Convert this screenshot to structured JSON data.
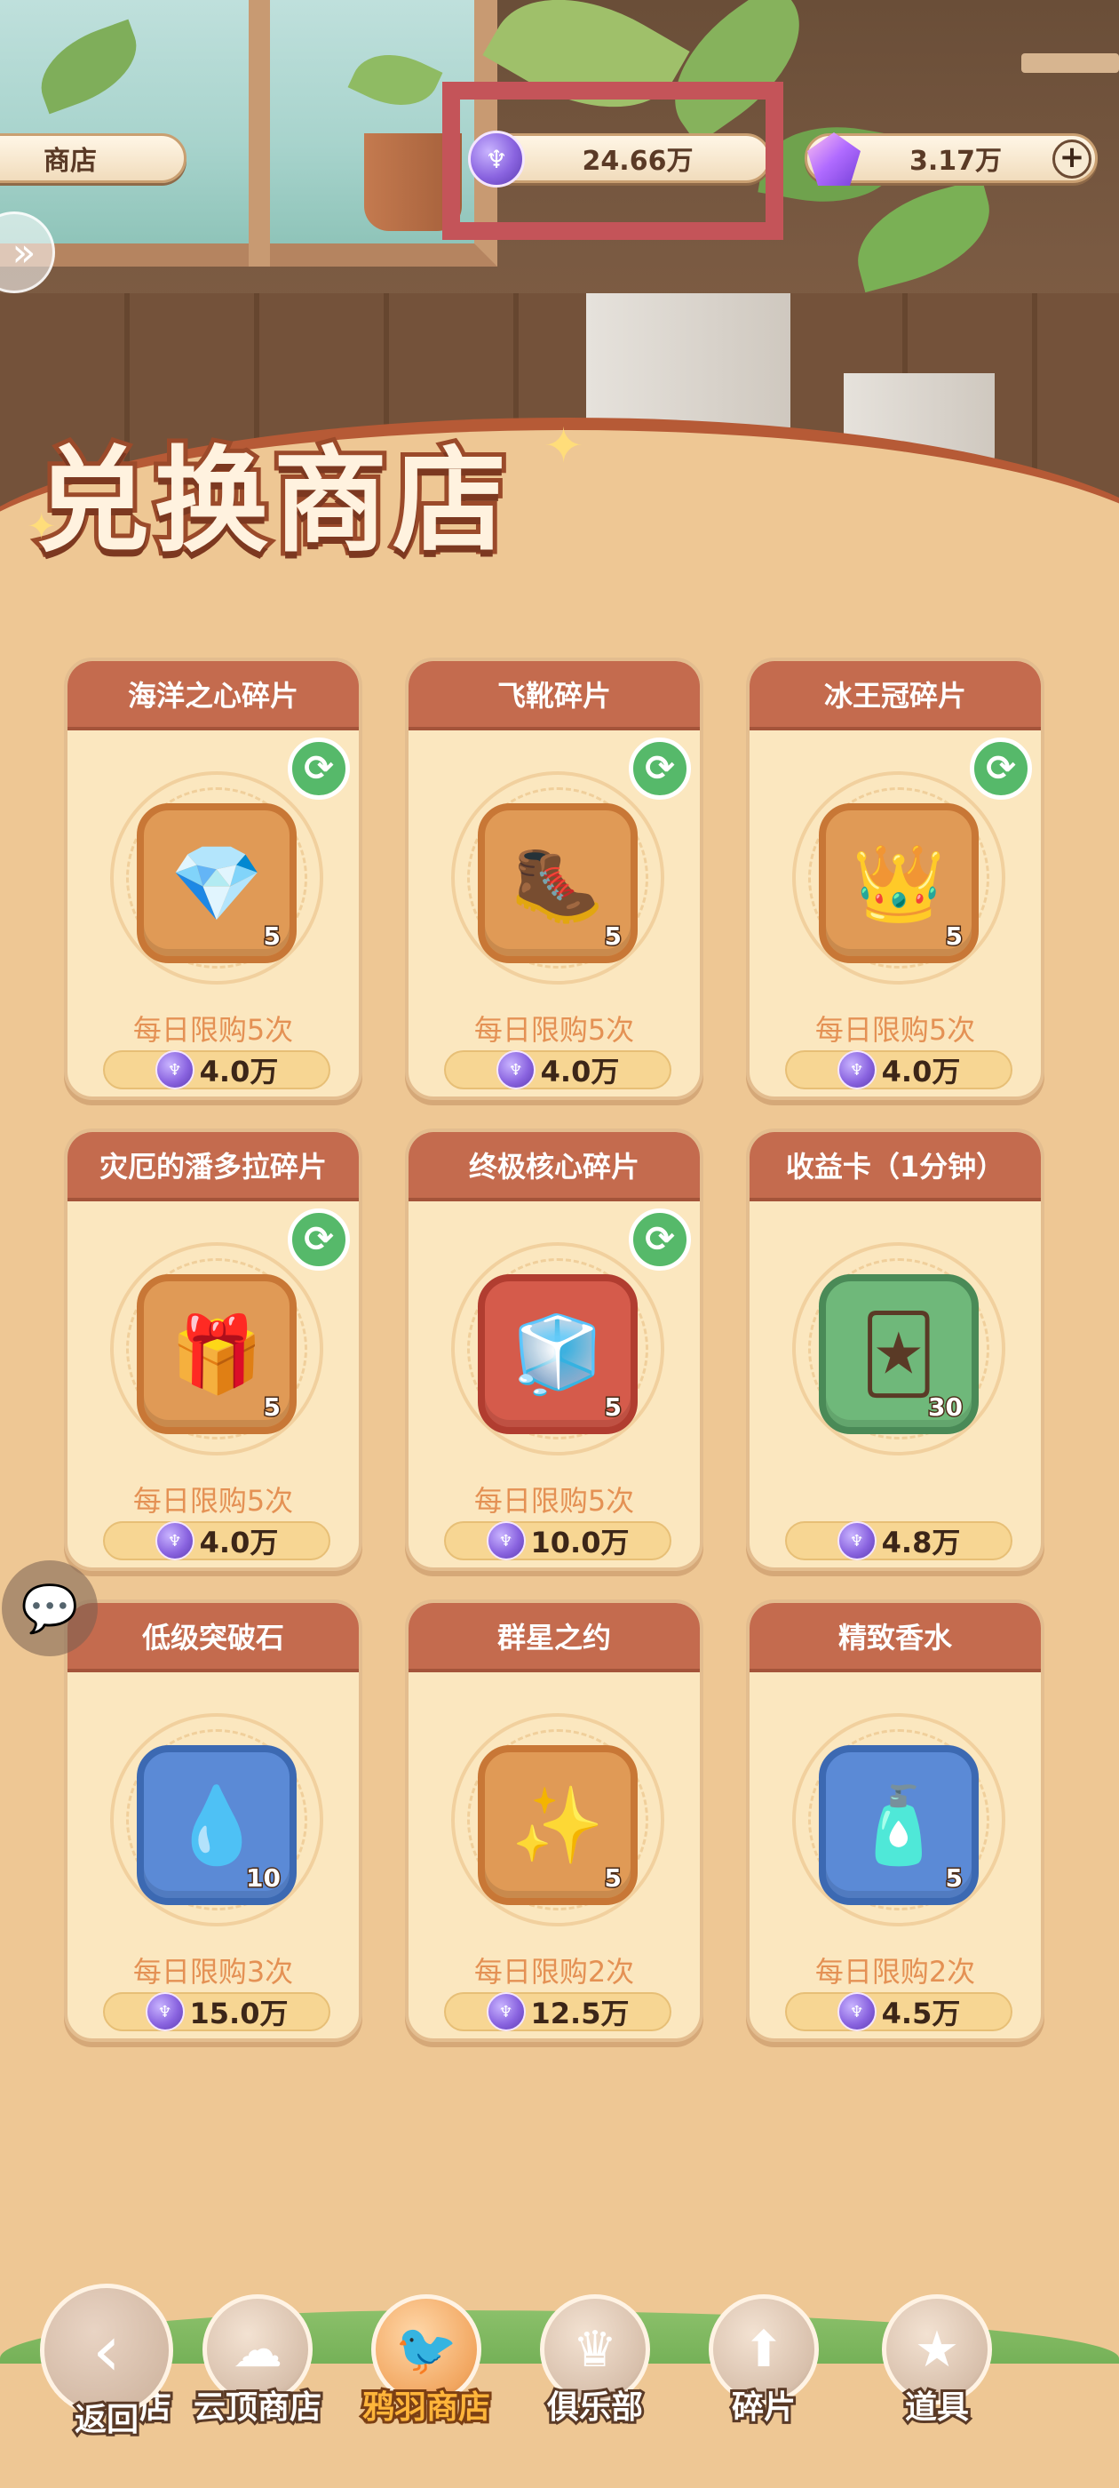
{
  "header": {
    "shop_tab_label": "商店",
    "currency_value": "24.66万",
    "gem_value": "3.17万",
    "plus_symbol": "+"
  },
  "banner": {
    "title": "兑换商店"
  },
  "items": [
    {
      "name": "海洋之心碎片",
      "count": "5",
      "limit": "每日限购5次",
      "price": "4.0万",
      "refreshable": true,
      "icon": "heart-gem-icon",
      "glyph": "💎",
      "tile": "orange"
    },
    {
      "name": "飞靴碎片",
      "count": "5",
      "limit": "每日限购5次",
      "price": "4.0万",
      "refreshable": true,
      "icon": "boots-icon",
      "glyph": "🥾",
      "tile": "orange"
    },
    {
      "name": "冰王冠碎片",
      "count": "5",
      "limit": "每日限购5次",
      "price": "4.0万",
      "refreshable": true,
      "icon": "ice-crown-icon",
      "glyph": "👑",
      "tile": "orange"
    },
    {
      "name": "灾厄的潘多拉碎片",
      "count": "5",
      "limit": "每日限购5次",
      "price": "4.0万",
      "refreshable": true,
      "icon": "pandora-box-icon",
      "glyph": "🎁",
      "tile": "orange"
    },
    {
      "name": "终极核心碎片",
      "count": "5",
      "limit": "每日限购5次",
      "price": "10.0万",
      "refreshable": true,
      "icon": "ultimate-core-icon",
      "glyph": "🧊",
      "tile": "red"
    },
    {
      "name": "收益卡（1分钟）",
      "count": "30",
      "limit": "",
      "price": "4.8万",
      "refreshable": false,
      "icon": "income-card-icon",
      "glyph": "🃏",
      "tile": "green"
    },
    {
      "name": "低级突破石",
      "count": "10",
      "limit": "每日限购3次",
      "price": "15.0万",
      "refreshable": false,
      "icon": "breakthrough-stone-icon",
      "glyph": "💧",
      "tile": "blue"
    },
    {
      "name": "群星之约",
      "count": "5",
      "limit": "每日限购2次",
      "price": "12.5万",
      "refreshable": false,
      "icon": "star-dreamcatcher-icon",
      "glyph": "✨",
      "tile": "orange"
    },
    {
      "name": "精致香水",
      "count": "5",
      "limit": "每日限购2次",
      "price": "4.5万",
      "refreshable": false,
      "icon": "perfume-bottle-icon",
      "glyph": "🧴",
      "tile": "blue"
    }
  ],
  "bottom_nav": {
    "back_label": "返回",
    "items": [
      {
        "label": "店",
        "icon": "shop-icon",
        "active": false
      },
      {
        "label": "云顶商店",
        "icon": "cloud-top-shop-icon",
        "active": false
      },
      {
        "label": "鸦羽商店",
        "icon": "raven-feather-shop-icon",
        "active": true
      },
      {
        "label": "俱乐部",
        "icon": "club-crown-icon",
        "active": false
      },
      {
        "label": "碎片",
        "icon": "fragments-icon",
        "active": false
      },
      {
        "label": "道具",
        "icon": "props-star-icon",
        "active": false
      }
    ]
  },
  "colors": {
    "background": "#eec794",
    "card_header": "#c46b4e",
    "limit_text": "#e49154",
    "highlight_box": "#c45459",
    "active_nav": "#ffb53a"
  }
}
